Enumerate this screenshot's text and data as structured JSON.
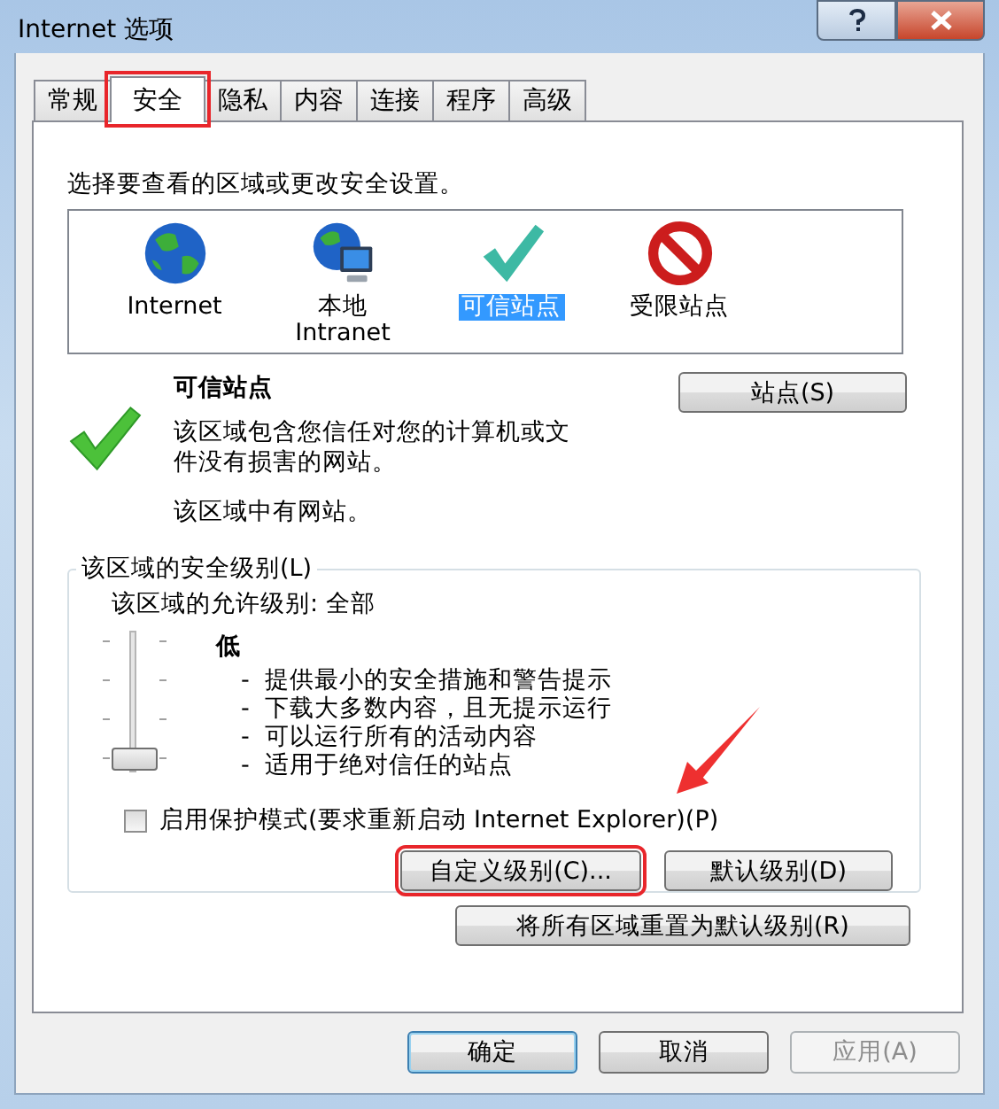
{
  "window": {
    "title": "Internet 选项"
  },
  "tabs": [
    {
      "label": "常规",
      "selected": false,
      "highlighted": false
    },
    {
      "label": "安全",
      "selected": true,
      "highlighted": true
    },
    {
      "label": "隐私",
      "selected": false,
      "highlighted": false
    },
    {
      "label": "内容",
      "selected": false,
      "highlighted": false
    },
    {
      "label": "连接",
      "selected": false,
      "highlighted": false
    },
    {
      "label": "程序",
      "selected": false,
      "highlighted": false
    },
    {
      "label": "高级",
      "selected": false,
      "highlighted": false
    }
  ],
  "zones": {
    "prompt": "选择要查看的区域或更改安全设置。",
    "items": [
      {
        "kind": "internet",
        "label": "Internet",
        "selected": false
      },
      {
        "kind": "intranet",
        "label": "本地\nIntranet",
        "selected": false
      },
      {
        "kind": "trusted",
        "label": "可信站点",
        "selected": true
      },
      {
        "kind": "restricted",
        "label": "受限站点",
        "selected": false
      }
    ]
  },
  "zone_info": {
    "title": "可信站点",
    "description": "该区域包含您信任对您的计算机或文件没有损害的网站。",
    "note": "该区域中有网站。",
    "sites_button": "站点(S)"
  },
  "security_level": {
    "legend": "该区域的安全级别(L)",
    "allowed": "该区域的允许级别: 全部",
    "slider": {
      "level": 0
    },
    "level_name": "低",
    "bullets": [
      "-  提供最小的安全措施和警告提示",
      "-  下载大多数内容，且无提示运行",
      "-  可以运行所有的活动内容",
      "-  适用于绝对信任的站点"
    ],
    "protected_mode": {
      "label": "启用保护模式(要求重新启动 Internet Explorer)(P)",
      "checked": false
    },
    "buttons": [
      {
        "label": "自定义级别(C)...",
        "highlighted": true
      },
      {
        "label": "默认级别(D)",
        "highlighted": false
      }
    ]
  },
  "reset_button": "将所有区域重置为默认级别(R)",
  "dialog_buttons": [
    {
      "label": "确定",
      "default": true,
      "disabled": false
    },
    {
      "label": "取消",
      "default": false,
      "disabled": false
    },
    {
      "label": "应用(A)",
      "default": false,
      "disabled": true
    }
  ],
  "annotation_arrow": true
}
